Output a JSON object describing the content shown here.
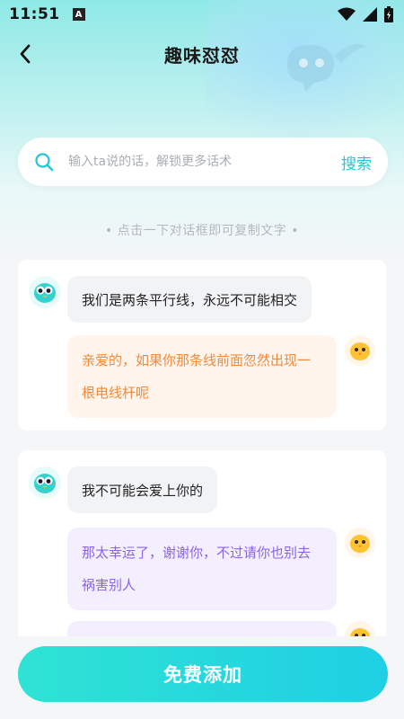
{
  "status": {
    "time": "11:51",
    "a_badge": "A"
  },
  "header": {
    "title": "趣味怼怼"
  },
  "search": {
    "placeholder": "输入ta说的话，解锁更多话术",
    "button_label": "搜索"
  },
  "hint": "• 点击一下对话框即可复制文字 •",
  "conversations": [
    {
      "question": "我们是两条平行线，永远不可能相交",
      "answers": [
        "亲爱的，如果你那条线前面忽然出现一根电线杆呢"
      ]
    },
    {
      "question": "我不可能会爱上你的",
      "answers": [
        "那太幸运了，谢谢你，不过请你也别去祸害别人",
        "......"
      ]
    }
  ],
  "cta": {
    "label": "免费添加"
  },
  "colors": {
    "accent": "#21c6d8",
    "cta_start": "#2ee3d4",
    "cta_end": "#1fcfe4",
    "answer_orange": "#f08a3c",
    "answer_purple": "#8a63e6"
  },
  "icons": [
    "back-arrow-icon",
    "search-icon",
    "wifi-icon",
    "signal-icon",
    "battery-icon",
    "bird-avatar-icon",
    "chick-avatar-icon"
  ]
}
